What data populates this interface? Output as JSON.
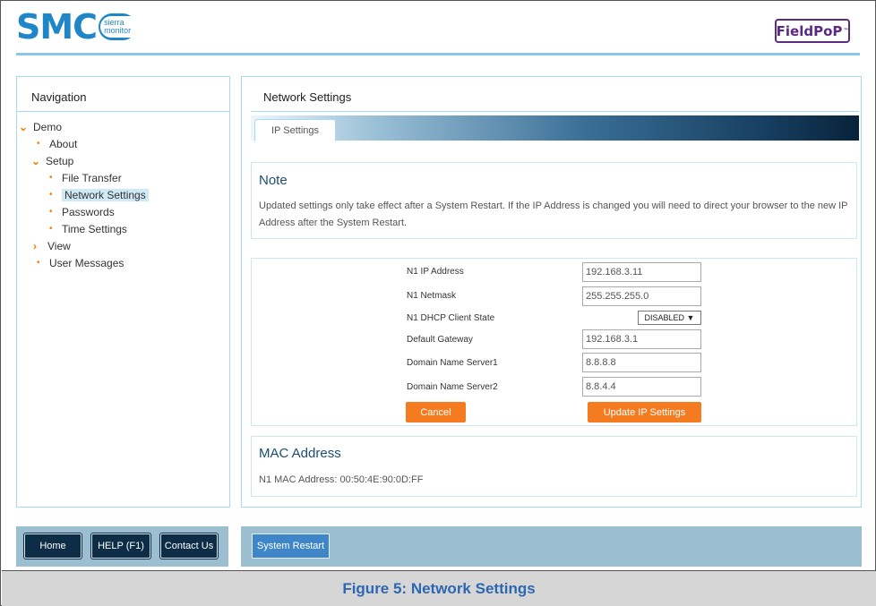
{
  "header": {
    "logo_text": "SMC",
    "logo_sub": "sierra monitor",
    "brand": "FieldPoP",
    "brand_mark": "™"
  },
  "nav": {
    "title": "Navigation",
    "items": [
      {
        "label": "Demo",
        "marker": "chevron-down"
      },
      {
        "label": "About",
        "marker": "bullet"
      },
      {
        "label": "Setup",
        "marker": "chevron-down"
      },
      {
        "label": "File Transfer",
        "marker": "bullet"
      },
      {
        "label": "Network Settings",
        "marker": "bullet",
        "active": true
      },
      {
        "label": "Passwords",
        "marker": "bullet"
      },
      {
        "label": "Time Settings",
        "marker": "bullet"
      },
      {
        "label": "View",
        "marker": "chevron-right"
      },
      {
        "label": "User Messages",
        "marker": "bullet"
      }
    ]
  },
  "content": {
    "title": "Network Settings",
    "tab": "IP Settings",
    "note": {
      "title": "Note",
      "text": "Updated settings only take effect after a System Restart. If the IP Address is changed you will need to direct your browser to the new IP Address after the System Restart."
    },
    "form": {
      "fields": [
        {
          "label": "N1 IP Address",
          "value": "192.168.3.11"
        },
        {
          "label": "N1 Netmask",
          "value": "255.255.255.0"
        },
        {
          "label": "N1 DHCP Client State",
          "value": "DISABLED ▼"
        },
        {
          "label": "Default Gateway",
          "value": "192.168.3.1"
        },
        {
          "label": "Domain Name Server1",
          "value": "8.8.8.8"
        },
        {
          "label": "Domain Name Server2",
          "value": "8.8.4.4"
        }
      ],
      "cancel_label": "Cancel",
      "update_label": "Update IP Settings"
    },
    "mac": {
      "title": "MAC Address",
      "text": "N1 MAC Address: 00:50:4E:90:0D:FF"
    }
  },
  "footer": {
    "home": "Home",
    "help": "HELP (F1)",
    "contact": "Contact Us",
    "restart": "System Restart"
  },
  "caption": "Figure 5: Network Settings",
  "colors": {
    "accent_orange": "#f47b20",
    "nav_dark": "#0d2c45",
    "footer_bar": "#9bbfd0",
    "caption_text": "#2e67b1"
  }
}
